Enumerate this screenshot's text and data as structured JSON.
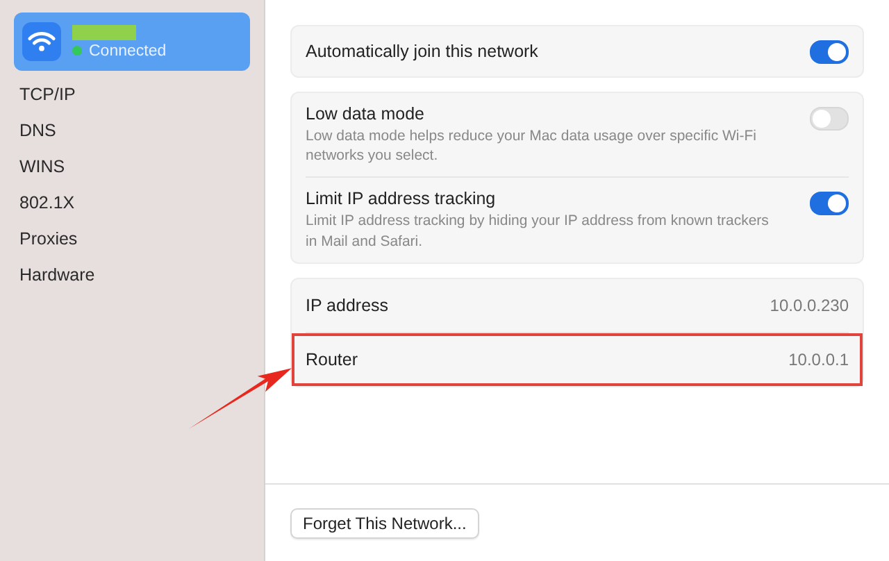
{
  "sidebar": {
    "network": {
      "status": "Connected",
      "connected": true,
      "selected": true,
      "name_redacted": true
    },
    "items": [
      {
        "label": "TCP/IP",
        "selected": false
      },
      {
        "label": "DNS",
        "selected": false
      },
      {
        "label": "WINS",
        "selected": false
      },
      {
        "label": "802.1X",
        "selected": false
      },
      {
        "label": "Proxies",
        "selected": false
      },
      {
        "label": "Hardware",
        "selected": false
      }
    ]
  },
  "settings_groups": [
    {
      "rows": [
        {
          "kind": "toggle",
          "label": "Automatically join this network",
          "on": true
        }
      ]
    },
    {
      "rows": [
        {
          "kind": "toggle",
          "label": "Low data mode",
          "description": "Low data mode helps reduce your Mac data usage over specific Wi-Fi networks you select.",
          "on": false
        },
        {
          "kind": "toggle",
          "label": "Limit IP address tracking",
          "description": "Limit IP address tracking by hiding your IP address from known trackers in Mail and Safari.",
          "on": true
        }
      ]
    },
    {
      "rows": [
        {
          "kind": "info",
          "label": "IP address",
          "value": "10.0.0.230",
          "highlighted": false
        },
        {
          "kind": "info",
          "label": "Router",
          "value": "10.0.0.1",
          "highlighted": true
        }
      ]
    }
  ],
  "annotation_arrow": true,
  "footer": {
    "button": "Forget This Network..."
  }
}
